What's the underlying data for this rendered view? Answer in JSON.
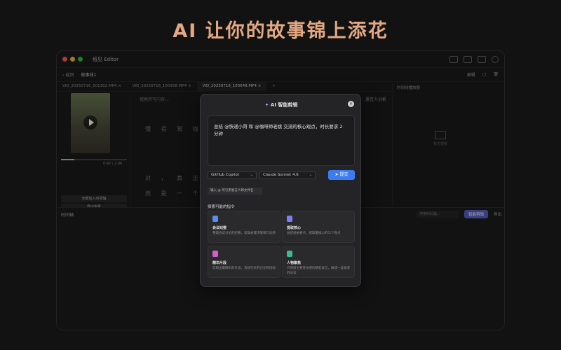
{
  "headline": "AI 让你的故事锦上添花",
  "window": {
    "title": "纸见 Editor",
    "back_label": "返回",
    "project_name": "故事线1",
    "edit_label": "编辑"
  },
  "tabs": [
    "VID_20250716_101302.MP4 ×",
    "VID_20250716_100958.MP4 ×",
    "VID_20250716_100648.MP4 ×",
    "+"
  ],
  "left": {
    "time": "0:42 / 2:06",
    "btn_add": "全部加入时间轴",
    "btn_export": "导出字幕"
  },
  "middle": {
    "search_placeholder": "搜索转写内容…",
    "speaker_label": "发言人分析",
    "row1": "懂 得 骂 咖 啡",
    "row2": "对 ， 真 正 的",
    "row3": "然 是 一 个 次"
  },
  "right": {
    "title": "时间线播放器",
    "placeholder": "暂无视频"
  },
  "timeline": {
    "label": "时间轴",
    "search": "搜索时间轴…",
    "smart_btn": "智能剪辑",
    "export": "导出"
  },
  "modal": {
    "title": "AI 智能剪辑",
    "prompt": "总结 @快递小哥 和 @咖啡师老姚 交流的核心观点，时长要求 2 分钟",
    "provider": "GitHub Copilot",
    "model": "Claude Sonnet 4.6",
    "send": "提交",
    "hint": "输入 @ 可引用发言人和文件名",
    "section": "探索可能的指令",
    "cards": [
      {
        "title": "会议纪要",
        "desc": "整理会议讨论的纪要，剪辑关键决策和行动项",
        "color": "#5b8cf0"
      },
      {
        "title": "提取核心",
        "desc": "总结相关要点，提取最核心的三个观点",
        "color": "#7a7ff5"
      },
      {
        "title": "精华片段",
        "desc": "剪辑出最精彩的片段，去除冗长的讨论和闲谈",
        "color": "#d65cc9"
      },
      {
        "title": "人物聚焦",
        "desc": "只保留主要受访者的精彩发言，做成一段紧凑的访谈",
        "color": "#3dbb8a"
      }
    ]
  }
}
